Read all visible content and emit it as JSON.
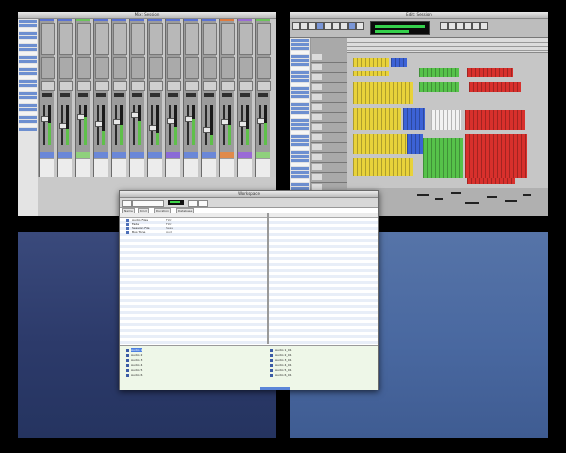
{
  "mix_window": {
    "title": "Mix: Session",
    "strip_caps": [
      "#5a72d4",
      "#5a72d4",
      "#6bc45a",
      "#5a72d4",
      "#5a72d4",
      "#5a72d4",
      "#5a72d4",
      "#5a72d4",
      "#5a72d4",
      "#5a72d4",
      "#e07a3c",
      "#9a6ad6",
      "#6bc45a"
    ],
    "name_colors": [
      "#6a87d8",
      "#6a87d8",
      "#8fd07c",
      "#6a87d8",
      "#6a87d8",
      "#6a87d8",
      "#6a87d8",
      "#8a6ad6",
      "#6a87d8",
      "#6a87d8",
      "#e08a4a",
      "#9a6ad6",
      "#8fd07c"
    ],
    "meter_levels": [
      0.55,
      0.4,
      0.7,
      0.35,
      0.5,
      0.6,
      0.3,
      0.45,
      0.65,
      0.25,
      0.5,
      0.4,
      0.55
    ],
    "fader_levels": [
      0.3,
      0.5,
      0.25,
      0.45,
      0.4,
      0.2,
      0.55,
      0.35,
      0.3,
      0.6,
      0.4,
      0.45,
      0.35
    ]
  },
  "edit_window": {
    "title": "Edit: Session",
    "counter_main": "00:00:00",
    "counter_sub": "00:00:00",
    "track_count": 16,
    "clip_colors": {
      "yellow": "#e8d23a",
      "blue": "#3c62d6",
      "green": "#56c24a",
      "red": "#d8302c",
      "white": "#f2f2f2"
    }
  },
  "browser": {
    "title": "Workspace",
    "tabs": [
      "Name",
      "Kind",
      "Duration",
      "Database"
    ],
    "top_items": [
      {
        "name": "Audio Files",
        "kind": "Fldr",
        "size": ""
      },
      {
        "name": "Fade",
        "kind": "Fldr",
        "size": ""
      },
      {
        "name": "Session File",
        "kind": "Sess",
        "size": ""
      },
      {
        "name": "Bus Tone",
        "kind": "Aud",
        "size": ""
      }
    ],
    "bottom_left": [
      {
        "name": "Audio 1"
      },
      {
        "name": "Audio 2"
      },
      {
        "name": "Audio 3"
      },
      {
        "name": "Audio 4"
      },
      {
        "name": "Audio 5"
      },
      {
        "name": "Audio 6"
      }
    ],
    "bottom_right": [
      {
        "name": "Audio 1_01"
      },
      {
        "name": "Audio 2_01"
      },
      {
        "name": "Audio 3_01"
      },
      {
        "name": "Audio 4_01"
      },
      {
        "name": "Audio 5_01"
      },
      {
        "name": "Audio 6_01"
      }
    ]
  }
}
